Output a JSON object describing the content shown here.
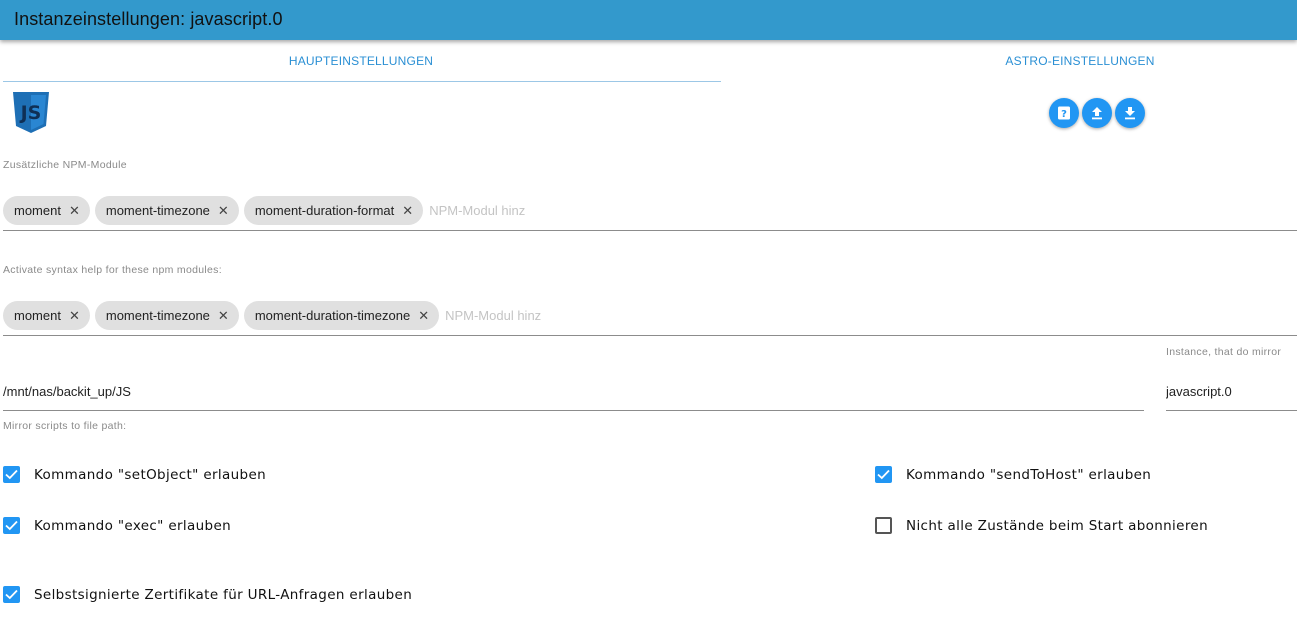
{
  "window": {
    "title": "Instanzeinstellungen: javascript.0"
  },
  "tabs": [
    {
      "label": "HAUPTEINSTELLUNGEN",
      "active": true
    },
    {
      "label": "ASTRO-EINSTELLUNGEN",
      "active": false
    }
  ],
  "logo": {
    "text": "JS",
    "color": "#1e6fb5"
  },
  "actions": [
    {
      "name": "help-icon"
    },
    {
      "name": "upload-icon"
    },
    {
      "name": "download-icon"
    }
  ],
  "npm_modules": {
    "label": "Zusätzliche NPM-Module",
    "chips": [
      "moment",
      "moment-timezone",
      "moment-duration-format"
    ],
    "placeholder": "NPM-Modul hinz"
  },
  "syntax_help": {
    "label": "Activate syntax help for these npm modules:",
    "chips": [
      "moment",
      "moment-timezone",
      "moment-duration-timezone"
    ],
    "placeholder": "NPM-Modul hinz"
  },
  "mirror": {
    "path_value": "/mnt/nas/backit_up/JS",
    "path_label": "Mirror scripts to file path:",
    "instance_label": "Instance, that do mirror",
    "instance_value": "javascript.0"
  },
  "checkboxes": [
    {
      "label": "Kommando \"setObject\" erlauben",
      "checked": true
    },
    {
      "label": "Kommando \"sendToHost\" erlauben",
      "checked": true
    },
    {
      "label": "Kommando \"exec\" erlauben",
      "checked": true
    },
    {
      "label": "Nicht alle Zustände beim Start abonnieren",
      "checked": false
    },
    {
      "label": "Selbstsignierte Zertifikate für URL-Anfragen erlauben",
      "checked": true
    }
  ],
  "colors": {
    "titlebar": "#3399cc",
    "accent": "#2196f3",
    "tab_text": "#2a8fd4"
  }
}
